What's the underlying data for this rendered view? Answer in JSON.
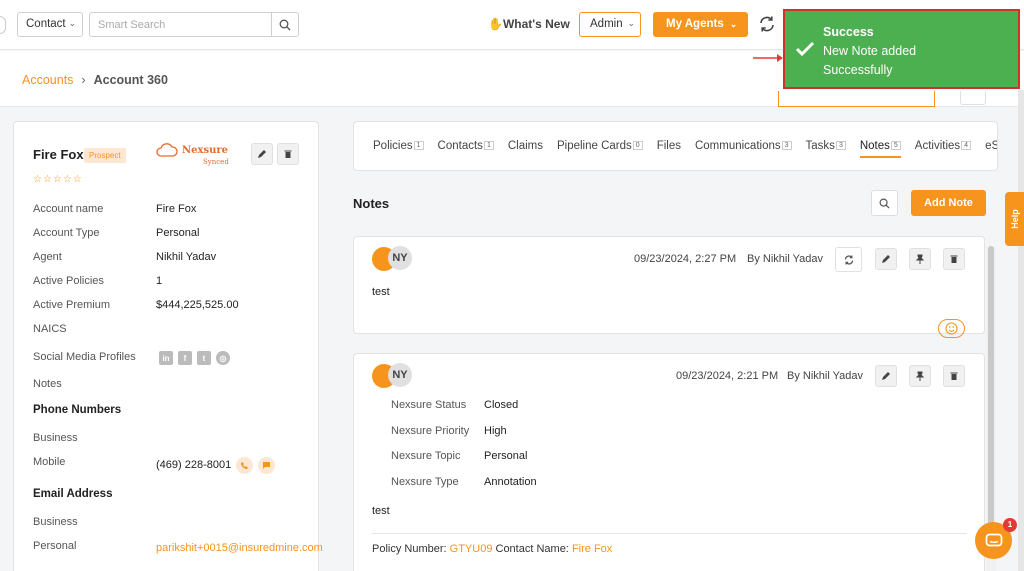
{
  "topbar": {
    "entity_select": "Contact",
    "search_placeholder": "Smart Search",
    "whats_new": "What's New",
    "admin_select": "Admin",
    "my_agents": "My Agents"
  },
  "toast": {
    "title": "Success",
    "line1": "New Note added",
    "line2": "Successfully"
  },
  "breadcrumb": {
    "parent": "Accounts",
    "current": "Account 360"
  },
  "account": {
    "name": "Fire Fox",
    "badge": "Prospect",
    "stars": "☆☆☆☆☆",
    "sync_brand": "Nexsure",
    "sync_status": "Synced",
    "fields": [
      {
        "label": "Account name",
        "value": "Fire Fox"
      },
      {
        "label": "Account Type",
        "value": "Personal"
      },
      {
        "label": "Agent",
        "value": "Nikhil Yadav"
      },
      {
        "label": "Active Policies",
        "value": "1"
      },
      {
        "label": "Active Premium",
        "value": "$444,225,525.00"
      },
      {
        "label": "NAICS",
        "value": ""
      },
      {
        "label": "Social Media Profiles",
        "value": ""
      },
      {
        "label": "Notes",
        "value": ""
      }
    ],
    "social_icons": [
      "in",
      "f",
      "t"
    ],
    "phone_heading": "Phone Numbers",
    "phones": [
      {
        "label": "Business",
        "value": ""
      },
      {
        "label": "Mobile",
        "value": "(469) 228-8001"
      }
    ],
    "email_heading": "Email Address",
    "emails": [
      {
        "label": "Business",
        "value": ""
      },
      {
        "label": "Personal",
        "value": "parikshit+0015@insuredmine.com"
      }
    ]
  },
  "tabs": [
    {
      "label": "Policies",
      "count": "1"
    },
    {
      "label": "Contacts",
      "count": "1"
    },
    {
      "label": "Claims",
      "count": ""
    },
    {
      "label": "Pipeline Cards",
      "count": "0"
    },
    {
      "label": "Files",
      "count": ""
    },
    {
      "label": "Communications",
      "count": "3"
    },
    {
      "label": "Tasks",
      "count": "3"
    },
    {
      "label": "Notes",
      "count": "5"
    },
    {
      "label": "Activities",
      "count": "4"
    },
    {
      "label": "eSign",
      "count": ""
    }
  ],
  "notes_section": {
    "title": "Notes",
    "add_label": "Add Note"
  },
  "notes": [
    {
      "initials": "NY",
      "date": "09/23/2024, 2:27 PM",
      "author": "By Nikhil Yadav",
      "body": "test"
    },
    {
      "initials": "NY",
      "date": "09/23/2024, 2:21 PM",
      "author": "By Nikhil Yadav",
      "fields": [
        {
          "label": "Nexsure Status",
          "value": "Closed"
        },
        {
          "label": "Nexsure Priority",
          "value": "High"
        },
        {
          "label": "Nexsure Topic",
          "value": "Personal"
        },
        {
          "label": "Nexsure Type",
          "value": "Annotation"
        }
      ],
      "body": "test",
      "policy_label": "Policy Number:",
      "policy_value": "GTYU09",
      "contact_label": "Contact Name:",
      "contact_value": "Fire Fox"
    }
  ],
  "help_label": "Help",
  "chat_badge": "1",
  "colors": {
    "accent": "#f7941d",
    "toast_bg": "#4caf50",
    "toast_border": "#d32f2f"
  }
}
